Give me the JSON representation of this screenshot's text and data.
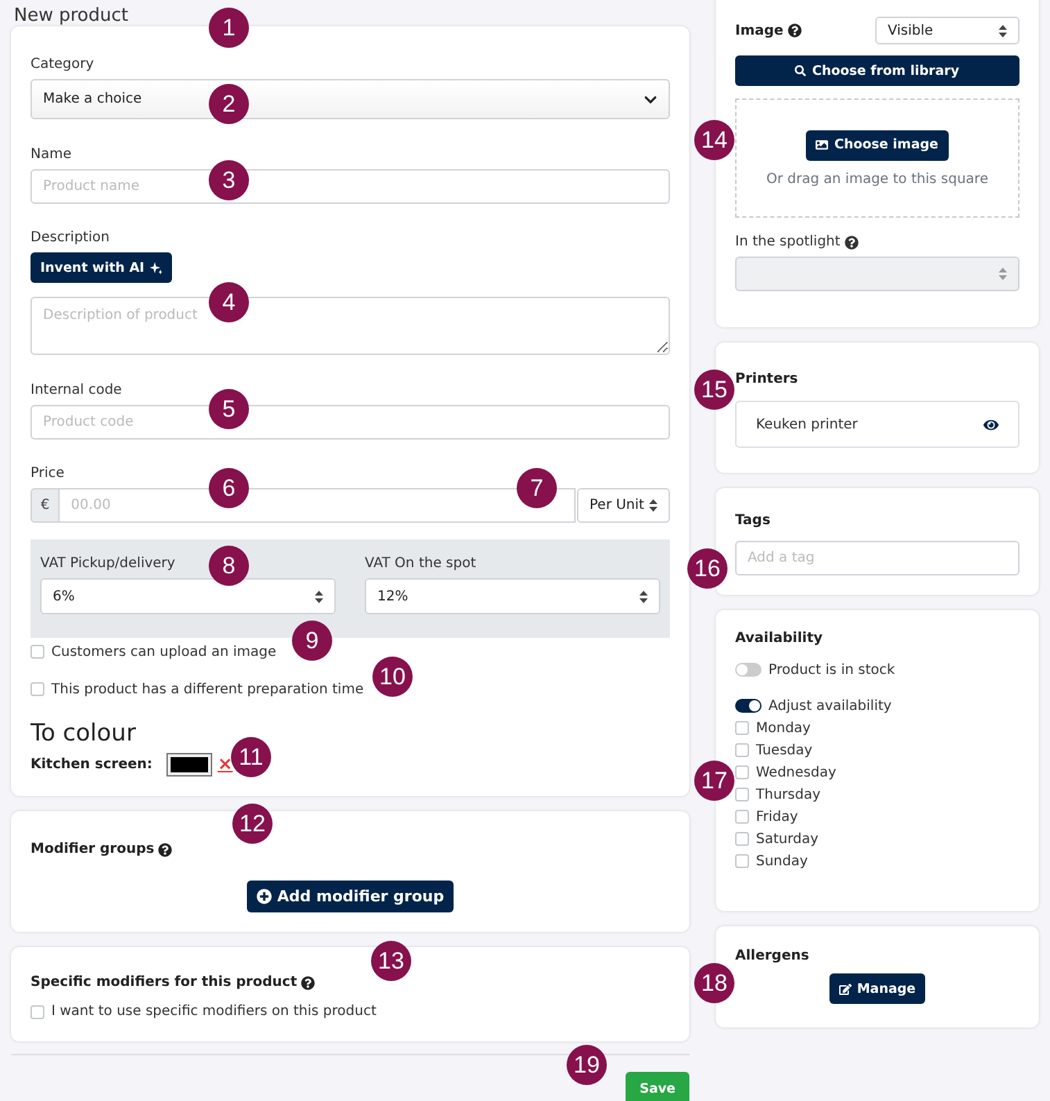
{
  "page_title": "New product",
  "form": {
    "category": {
      "label": "Category",
      "value": "Make a choice"
    },
    "name": {
      "label": "Name",
      "placeholder": "Product name"
    },
    "description": {
      "label": "Description",
      "ai_button": "Invent with AI",
      "placeholder": "Description of product"
    },
    "internal_code": {
      "label": "Internal code",
      "placeholder": "Product code"
    },
    "price": {
      "label": "Price",
      "currency": "€",
      "placeholder": "00.00",
      "unit": "Per Unit"
    },
    "vat": [
      {
        "label": "VAT Pickup/delivery",
        "value": "6%"
      },
      {
        "label": "VAT On the spot",
        "value": "12%"
      }
    ],
    "options": [
      {
        "label": "Customers can upload an image",
        "checked": false
      },
      {
        "label": "This product has a different preparation time",
        "checked": false
      }
    ],
    "colour": {
      "heading": "To colour",
      "label": "Kitchen screen:",
      "color": "#000000",
      "clear": "×"
    }
  },
  "modifier_groups": {
    "title": "Modifier groups",
    "button": "Add modifier group"
  },
  "specific_modifiers": {
    "title": "Specific modifiers for this product",
    "option": {
      "label": "I want to use specific modifiers on this product",
      "checked": false
    }
  },
  "save": "Save",
  "image": {
    "label": "Image",
    "visibility": "Visible",
    "library_button": "Choose from library",
    "choose_button": "Choose image",
    "drop_hint": "Or drag an image to this square",
    "spotlight_label": "In the spotlight",
    "spotlight_disabled": true
  },
  "printers": {
    "title": "Printers",
    "items": [
      {
        "name": "Keuken printer"
      }
    ]
  },
  "tags": {
    "title": "Tags",
    "placeholder": "Add a tag"
  },
  "availability": {
    "title": "Availability",
    "toggles": [
      {
        "label": "Product is in stock",
        "on": false
      },
      {
        "label": "Adjust availability",
        "on": true
      }
    ],
    "days": [
      {
        "label": "Monday",
        "checked": false
      },
      {
        "label": "Tuesday",
        "checked": false
      },
      {
        "label": "Wednesday",
        "checked": false
      },
      {
        "label": "Thursday",
        "checked": false
      },
      {
        "label": "Friday",
        "checked": false
      },
      {
        "label": "Saturday",
        "checked": false
      },
      {
        "label": "Sunday",
        "checked": false
      }
    ]
  },
  "allergens": {
    "title": "Allergens",
    "button": "Manage"
  },
  "markers": [
    "1",
    "2",
    "3",
    "4",
    "5",
    "6",
    "7",
    "8",
    "9",
    "10",
    "11",
    "12",
    "13",
    "14",
    "15",
    "16",
    "17",
    "18",
    "19"
  ]
}
